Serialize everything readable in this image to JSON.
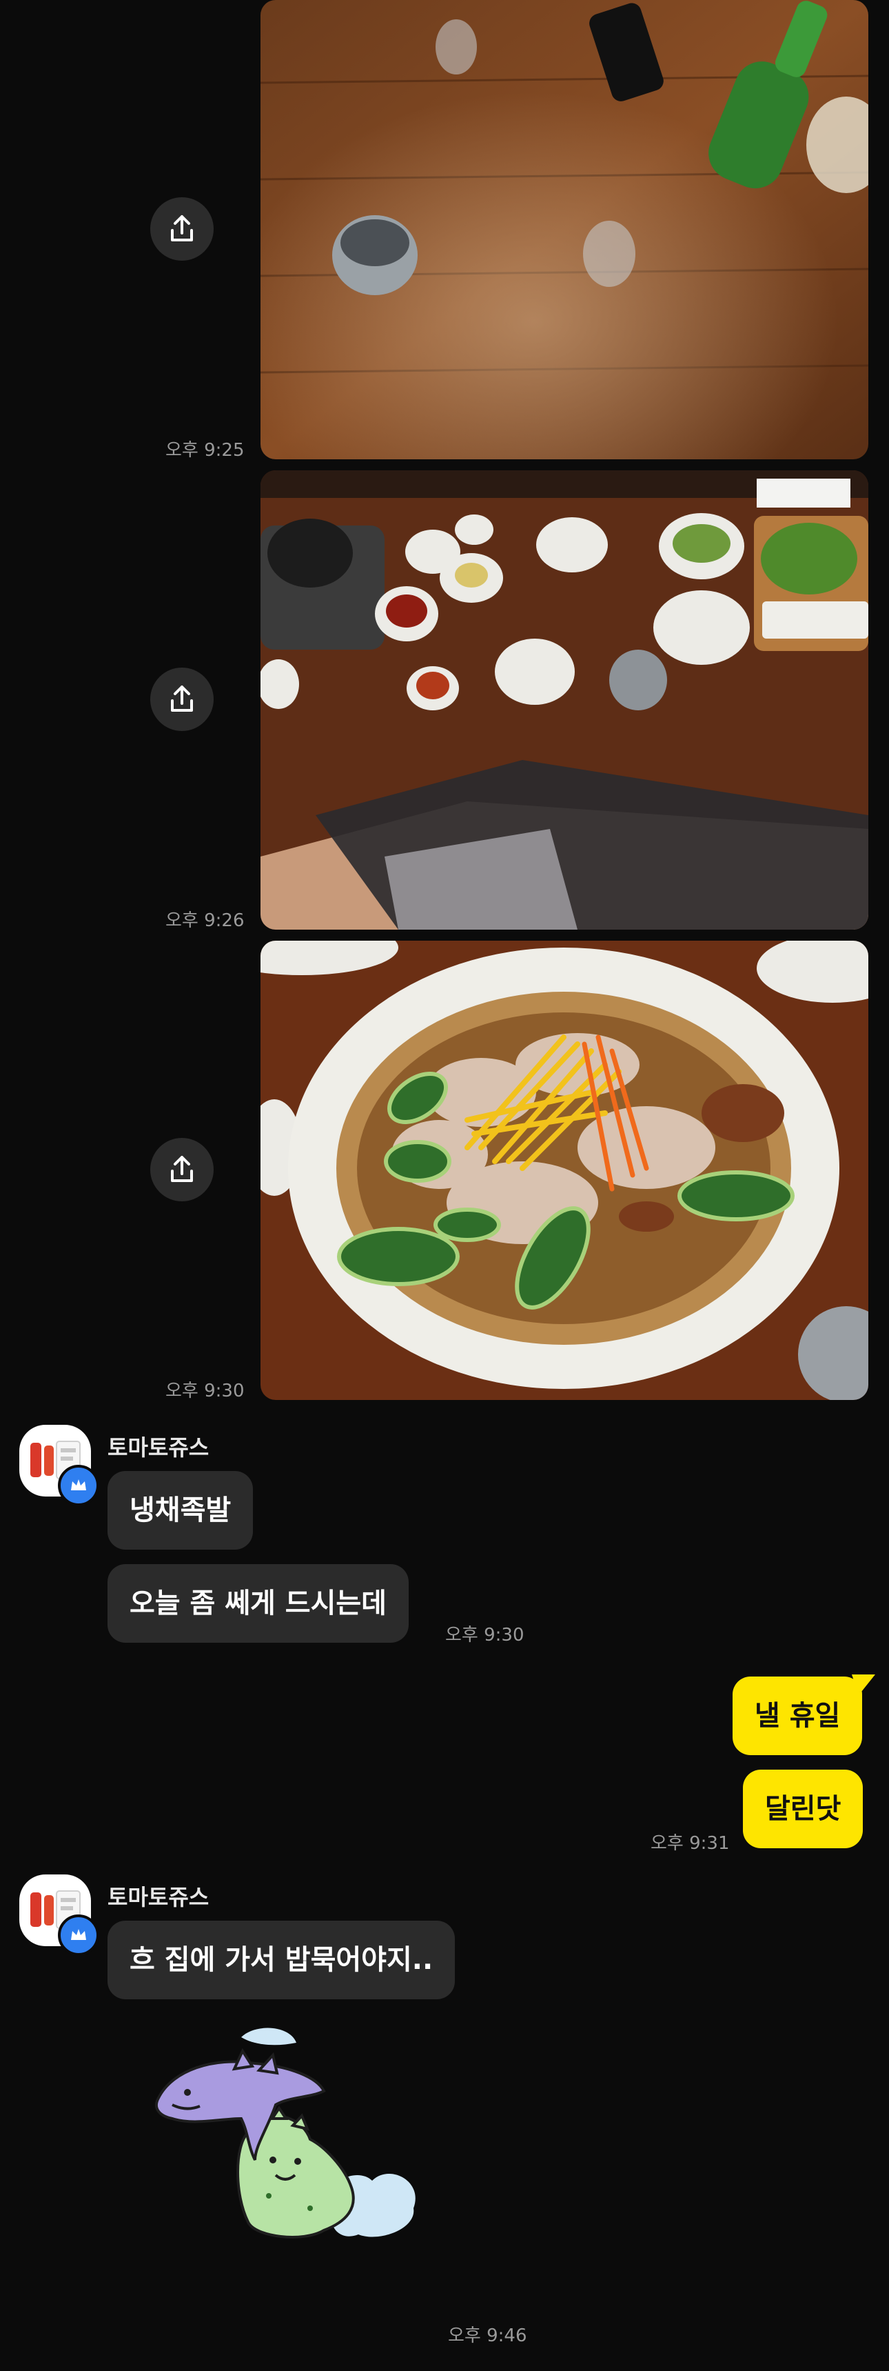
{
  "messages": {
    "photo1": {
      "time": "오후 9:25"
    },
    "photo2": {
      "time": "오후 9:26"
    },
    "photo3": {
      "time": "오후 9:30"
    },
    "group1": {
      "sender": "토마토쥬스",
      "bubbles": [
        "냉채족발",
        "오늘 좀 쎄게 드시는데"
      ],
      "time": "오후 9:30"
    },
    "outgoing": {
      "bubbles": [
        "낼 휴일",
        "달린닷"
      ],
      "time": "오후 9:31"
    },
    "group2": {
      "sender": "토마토쥬스",
      "bubbles": [
        "흐 집에 가서 밥묵어야지.."
      ],
      "time": "오후 9:46"
    }
  },
  "icons": {
    "share": "share-upload-icon",
    "avatar_badge": "crown-icon"
  },
  "colors": {
    "background": "#0b0b0b",
    "incoming_bubble": "#2b2b2b",
    "outgoing_bubble": "#fee500",
    "timestamp": "#9a9a9a",
    "badge": "#2f7ff0"
  }
}
